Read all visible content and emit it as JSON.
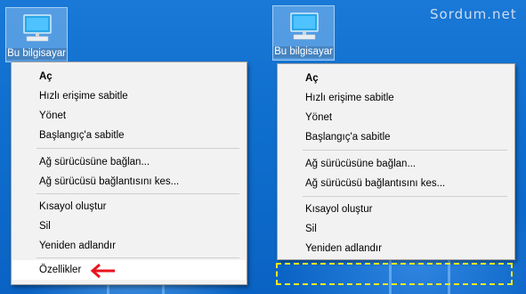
{
  "left_menu": {
    "items": [
      "Aç",
      "Hızlı erişime sabitle",
      "Yönet",
      "Başlangıç'a sabitle",
      "Ağ sürücüsüne bağlan...",
      "Ağ sürücüsü bağlantısını kes...",
      "Kısayol oluştur",
      "Sil",
      "Yeniden adlandır",
      "Özellikler"
    ]
  },
  "right_menu": {
    "items": [
      "Aç",
      "Hızlı erişime sabitle",
      "Yönet",
      "Başlangıç'a sabitle",
      "Ağ sürücüsüne bağlan...",
      "Ağ sürücüsü bağlantısını kes...",
      "Kısayol oluştur",
      "Sil",
      "Yeniden adlandır"
    ]
  },
  "desktop": {
    "icon_label": "Bu bilgisayar",
    "watermark": "Sordum.net"
  },
  "colors": {
    "arrow": "#e8141c",
    "highlight_box": "#f0e91f"
  },
  "icons": [
    "computer-icon",
    "left-arrow-icon"
  ]
}
